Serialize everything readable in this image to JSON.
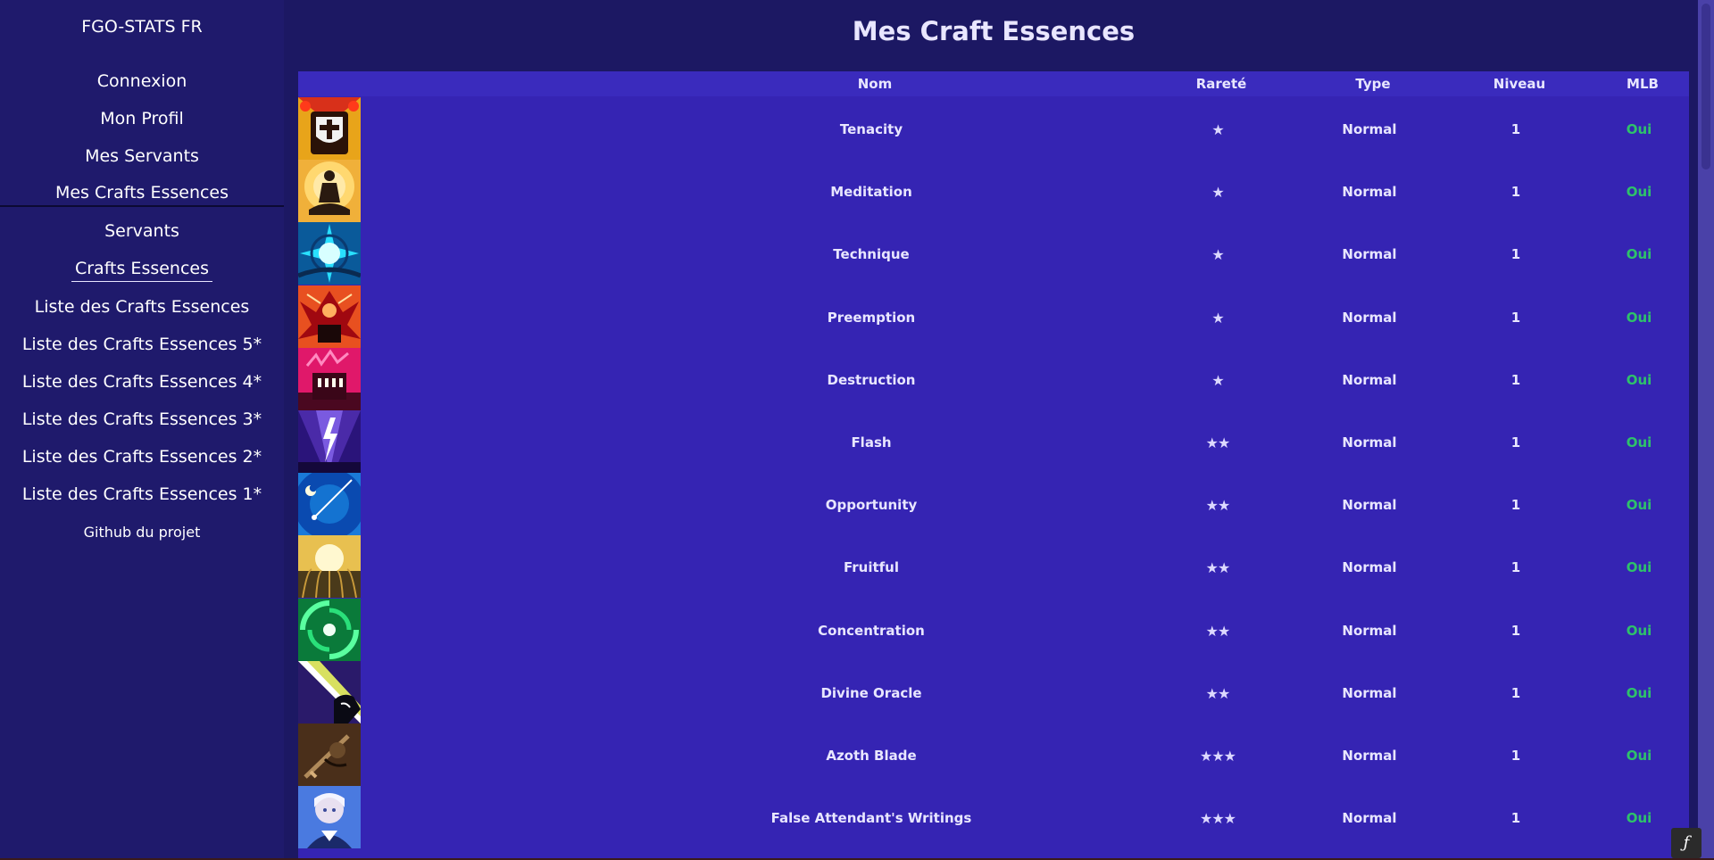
{
  "sidebar": {
    "brand": "FGO-STATS FR",
    "items": [
      {
        "label": "Connexion"
      },
      {
        "label": "Mon Profil"
      },
      {
        "label": "Mes Servants"
      },
      {
        "label": "Mes Crafts Essences"
      },
      {
        "label": "Servants"
      },
      {
        "label": "Crafts Essences"
      },
      {
        "label": "Liste des Crafts Essences"
      },
      {
        "label": "Liste des Crafts Essences 5*"
      },
      {
        "label": "Liste des Crafts Essences 4*"
      },
      {
        "label": "Liste des Crafts Essences 3*"
      },
      {
        "label": "Liste des Crafts Essences 2*"
      },
      {
        "label": "Liste des Crafts Essences 1*"
      },
      {
        "label": "Github du projet"
      }
    ]
  },
  "main": {
    "title": "Mes Craft Essences",
    "columns": [
      "Nom",
      "Rareté",
      "Type",
      "Niveau",
      "MLB"
    ],
    "rows": [
      {
        "name": "Tenacity",
        "rarity": "★",
        "type": "Normal",
        "level": "1",
        "mlb": "Oui",
        "icon": "shield-cross-icon"
      },
      {
        "name": "Meditation",
        "rarity": "★",
        "type": "Normal",
        "level": "1",
        "mlb": "Oui",
        "icon": "meditating-figure-icon"
      },
      {
        "name": "Technique",
        "rarity": "★",
        "type": "Normal",
        "level": "1",
        "mlb": "Oui",
        "icon": "cyan-burst-icon"
      },
      {
        "name": "Preemption",
        "rarity": "★",
        "type": "Normal",
        "level": "1",
        "mlb": "Oui",
        "icon": "red-winged-emblem-icon"
      },
      {
        "name": "Destruction",
        "rarity": "★",
        "type": "Normal",
        "level": "1",
        "mlb": "Oui",
        "icon": "pink-castle-icon"
      },
      {
        "name": "Flash",
        "rarity": "★★",
        "type": "Normal",
        "level": "1",
        "mlb": "Oui",
        "icon": "purple-lightning-icon"
      },
      {
        "name": "Opportunity",
        "rarity": "★★",
        "type": "Normal",
        "level": "1",
        "mlb": "Oui",
        "icon": "shooting-star-icon"
      },
      {
        "name": "Fruitful",
        "rarity": "★★",
        "type": "Normal",
        "level": "1",
        "mlb": "Oui",
        "icon": "golden-sun-wheat-icon"
      },
      {
        "name": "Concentration",
        "rarity": "★★",
        "type": "Normal",
        "level": "1",
        "mlb": "Oui",
        "icon": "green-swirl-icon"
      },
      {
        "name": "Divine Oracle",
        "rarity": "★★",
        "type": "Normal",
        "level": "1",
        "mlb": "Oui",
        "icon": "oracle-beam-icon"
      },
      {
        "name": "Azoth Blade",
        "rarity": "★★★",
        "type": "Normal",
        "level": "1",
        "mlb": "Oui",
        "icon": "azoth-blade-icon"
      },
      {
        "name": "False Attendant's Writings",
        "rarity": "★★★",
        "type": "Normal",
        "level": "1",
        "mlb": "Oui",
        "icon": "white-haired-portrait-icon"
      }
    ]
  },
  "colors": {
    "sidebar_bg": "#1f1a6c",
    "main_bg": "#1c1863",
    "table_bg": "#3524b3",
    "header_bg": "#3a2bbd",
    "mlb_green": "#2ec26a",
    "scrollbar": "#4a41a8"
  },
  "fab": {
    "glyph": "ƒ",
    "icon": "symfony-debug-icon"
  }
}
